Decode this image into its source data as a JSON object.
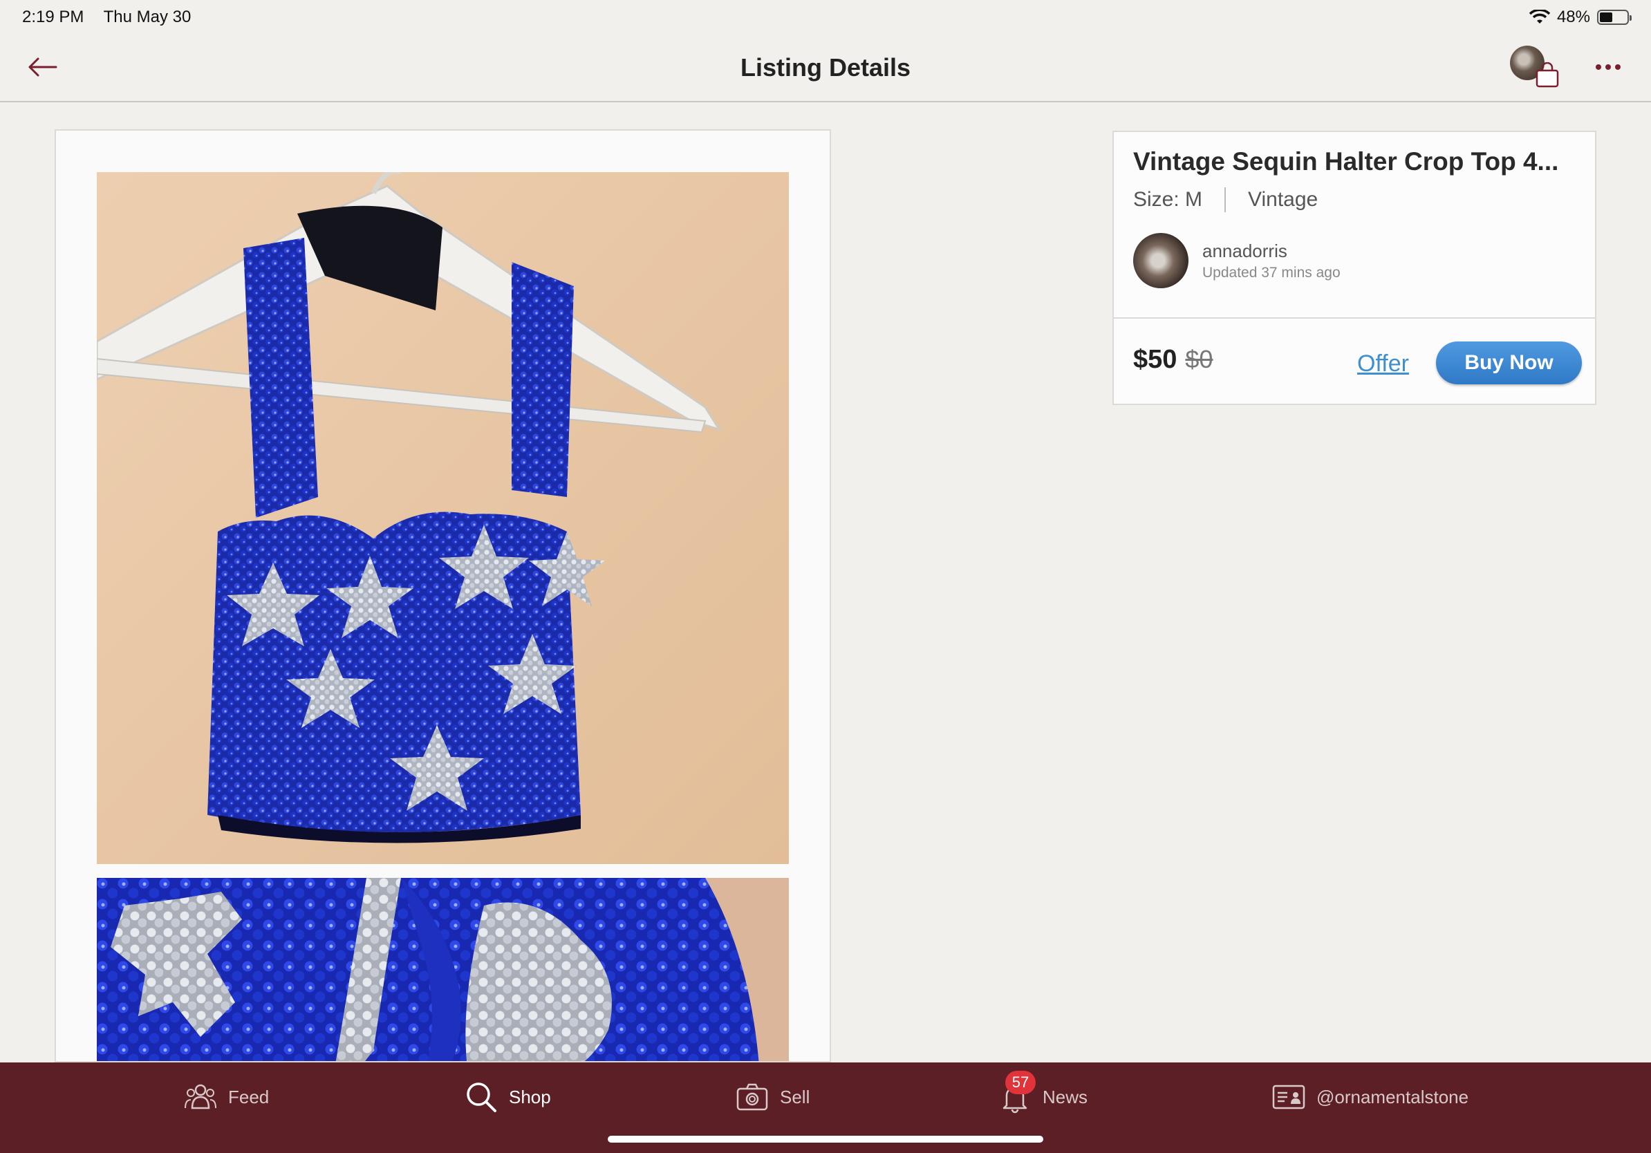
{
  "status_bar": {
    "time": "2:19 PM",
    "date": "Thu May 30",
    "battery": "48%",
    "battery_level": 0.48
  },
  "nav": {
    "title": "Listing Details"
  },
  "listing": {
    "title": "Vintage Sequin Halter Crop Top 4...",
    "size": "Size: M",
    "brand": "Vintage",
    "seller": {
      "name": "annadorris",
      "updated": "Updated 37 mins ago"
    },
    "price": "$50",
    "original_price": "$0",
    "offer_label": "Offer",
    "buy_label": "Buy Now"
  },
  "tabs": {
    "feed": "Feed",
    "shop": "Shop",
    "sell": "Sell",
    "news": "News",
    "news_badge": "57",
    "account": "@ornamentalstone"
  },
  "colors": {
    "accent": "#7a1f2e",
    "tabbar": "#5c1f26",
    "buy_button": "#2f79c6",
    "offer_link": "#3f8fce",
    "badge": "#e0333a"
  }
}
